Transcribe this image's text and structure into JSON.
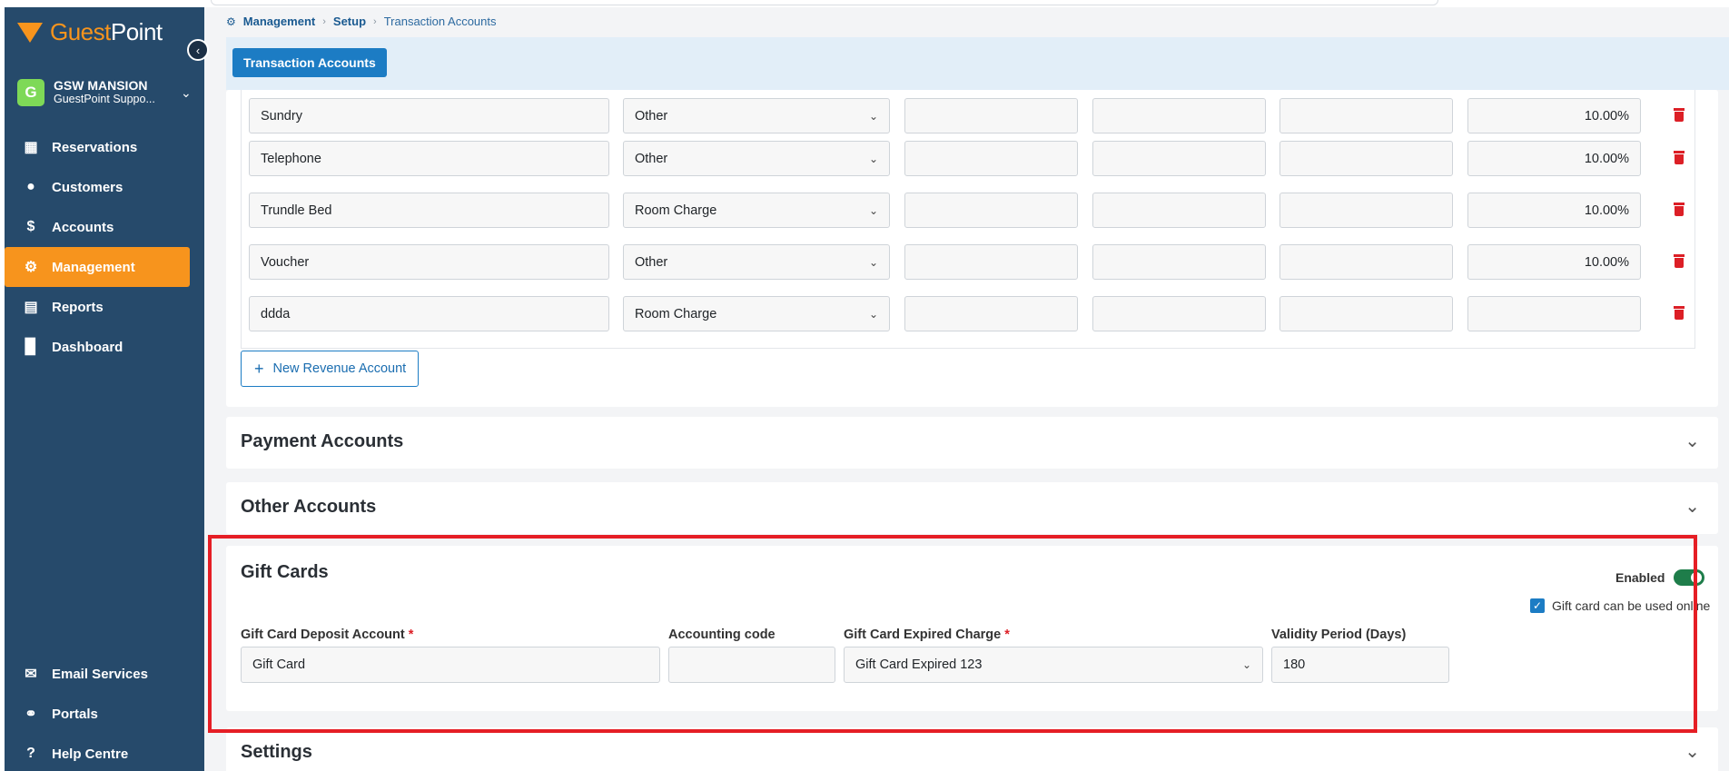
{
  "brand": {
    "guest": "Guest",
    "point": "Point"
  },
  "property": {
    "initial": "G",
    "name": "GSW MANSION",
    "subtitle": "GuestPoint Suppo..."
  },
  "nav": [
    {
      "label": "Reservations",
      "icon": "calendar-icon"
    },
    {
      "label": "Customers",
      "icon": "users-icon"
    },
    {
      "label": "Accounts",
      "icon": "dollar-icon"
    },
    {
      "label": "Management",
      "icon": "user-gear-icon",
      "active": true
    },
    {
      "label": "Reports",
      "icon": "report-icon"
    },
    {
      "label": "Dashboard",
      "icon": "bar-chart-icon"
    }
  ],
  "nav_bottom": [
    {
      "label": "Email Services",
      "icon": "email-icon"
    },
    {
      "label": "Portals",
      "icon": "link-icon"
    },
    {
      "label": "Help Centre",
      "icon": "help-icon"
    }
  ],
  "breadcrumb": [
    "Management",
    "Setup",
    "Transaction Accounts"
  ],
  "header": {
    "button": "Transaction Accounts"
  },
  "revenue_rows": [
    {
      "name": "Sundry",
      "type": "Other",
      "pct": "10.00%"
    },
    {
      "name": "Telephone",
      "type": "Other",
      "pct": "10.00%"
    },
    {
      "name": "Trundle Bed",
      "type": "Room Charge",
      "pct": "10.00%"
    },
    {
      "name": "Voucher",
      "type": "Other",
      "pct": "10.00%"
    },
    {
      "name": "ddda",
      "type": "Room Charge",
      "pct": ""
    }
  ],
  "new_revenue_button": "New Revenue Account",
  "sections": {
    "payment": "Payment Accounts",
    "other": "Other Accounts",
    "settings": "Settings"
  },
  "gift": {
    "title": "Gift Cards",
    "enabled_label": "Enabled",
    "enabled": true,
    "online_label": "Gift card can be used online",
    "online_checked": true,
    "deposit_label": "Gift Card Deposit Account",
    "deposit_value": "Gift Card",
    "code_label": "Accounting code",
    "code_value": "",
    "expired_label": "Gift Card Expired Charge",
    "expired_value": "Gift Card Expired 123",
    "validity_label": "Validity Period (Days)",
    "validity_value": "180"
  },
  "colors": {
    "sidebar": "#264a6b",
    "accent": "#f7941d",
    "primary": "#1c7cc4",
    "danger": "#dc1f26",
    "highlight": "#e51e25"
  }
}
